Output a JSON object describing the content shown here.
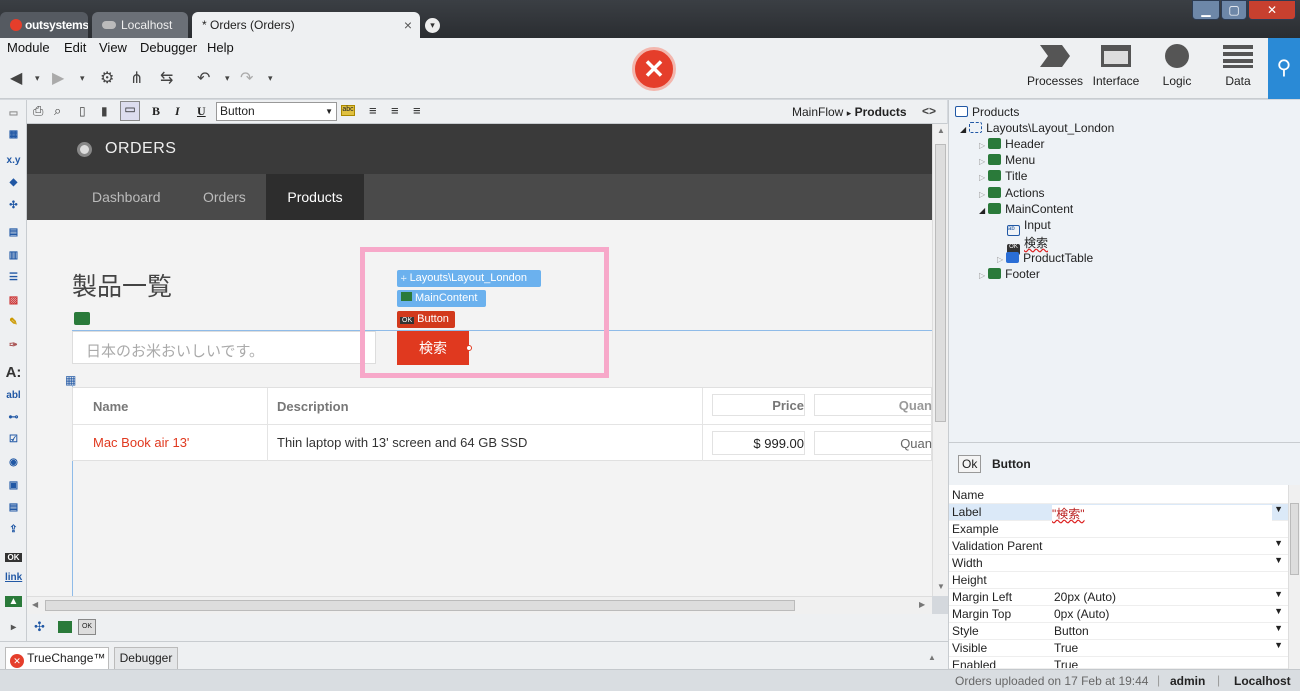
{
  "tabs": {
    "logo": "outsystems",
    "localhost": "Localhost",
    "orders": "* Orders (Orders)",
    "close": "×"
  },
  "window": {
    "minimize": "▁",
    "maximize": "▢",
    "close": "✕"
  },
  "menu": [
    "Module",
    "Edit",
    "View",
    "Debugger",
    "Help"
  ],
  "nav": [
    {
      "label": "Processes",
      "icon": "processes-icon"
    },
    {
      "label": "Interface",
      "icon": "interface-icon"
    },
    {
      "label": "Logic",
      "icon": "logic-icon"
    },
    {
      "label": "Data",
      "icon": "data-icon"
    }
  ],
  "editor_toolbar": {
    "widget_select": "Button",
    "breadcrumb_flow": "MainFlow",
    "breadcrumb_sep": "▸",
    "breadcrumb_screen": "Products",
    "toggle": "<>"
  },
  "app": {
    "title": "ORDERS",
    "tabs": [
      "Dashboard",
      "Orders",
      "Products"
    ],
    "active_tab": "Products",
    "heading": "製品一覧",
    "search_placeholder": "日本のお米おいしいです。",
    "search_button": "検索",
    "table": {
      "headers": [
        "Name",
        "Description",
        "Price",
        "Quan"
      ],
      "rows": [
        [
          "Mac Book air 13'",
          "Thin laptop with 13' screen and 64 GB SSD",
          "$ 999.00",
          "Quan"
        ]
      ]
    }
  },
  "selection_popup": {
    "layout": "Layouts\\Layout_London",
    "content": "MainContent",
    "widget": "Button"
  },
  "tree": [
    {
      "label": "Products",
      "level": 0,
      "icon": "screen-icon"
    },
    {
      "label": "Layouts\\Layout_London",
      "level": 1,
      "icon": "block-icon"
    },
    {
      "label": "Header",
      "level": 2,
      "icon": "placeholder-icon"
    },
    {
      "label": "Menu",
      "level": 2,
      "icon": "placeholder-icon"
    },
    {
      "label": "Title",
      "level": 2,
      "icon": "placeholder-icon"
    },
    {
      "label": "Actions",
      "level": 2,
      "icon": "placeholder-icon"
    },
    {
      "label": "MainContent",
      "level": 2,
      "icon": "placeholder-icon"
    },
    {
      "label": "Input",
      "level": 3,
      "icon": "input-icon"
    },
    {
      "label": "検索",
      "level": 3,
      "icon": "button-icon"
    },
    {
      "label": "ProductTable",
      "level": 3,
      "icon": "table-icon"
    },
    {
      "label": "Footer",
      "level": 2,
      "icon": "placeholder-icon"
    }
  ],
  "props_header": {
    "badge": "Ok",
    "title": "Button"
  },
  "properties": [
    {
      "key": "Name",
      "value": ""
    },
    {
      "key": "Label",
      "value": "\"検索\""
    },
    {
      "key": "Example",
      "value": ""
    },
    {
      "key": "Validation Parent",
      "value": ""
    },
    {
      "key": "Width",
      "value": ""
    },
    {
      "key": "Height",
      "value": ""
    },
    {
      "key": "Margin Left",
      "value": "20px (Auto)"
    },
    {
      "key": "Margin Top",
      "value": "0px (Auto)"
    },
    {
      "key": "Style",
      "value": "Button"
    },
    {
      "key": "Visible",
      "value": "True"
    },
    {
      "key": "Enabled",
      "value": "True"
    }
  ],
  "bottom_tabs": [
    "TrueChange™",
    "Debugger"
  ],
  "status": {
    "message": "Orders uploaded on 17 Feb at 19:44",
    "user": "admin",
    "server": "Localhost"
  },
  "colors": {
    "accent_red": "#e0391f",
    "brand_blue": "#2a8ad6",
    "highlight_pink": "#f7a8c9",
    "error_red": "#e53e2b"
  }
}
